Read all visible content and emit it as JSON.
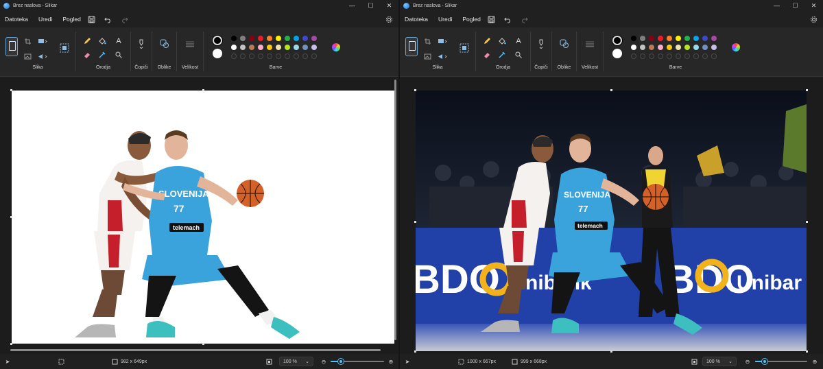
{
  "windows": [
    {
      "title": "Brez naslova - Slikar",
      "menu": [
        "Datoteka",
        "Uredi",
        "Pogled"
      ],
      "ribbon": {
        "groups": [
          "Slika",
          "Orodja",
          "Čopiči",
          "Oblike",
          "Velikost",
          "Barve"
        ]
      },
      "status": {
        "image_size": "982 x 649px",
        "zoom": "100 %"
      }
    },
    {
      "title": "Brez naslova - Slikar",
      "menu": [
        "Datoteka",
        "Uredi",
        "Pogled"
      ],
      "ribbon": {
        "groups": [
          "Slika",
          "Orodja",
          "Čopiči",
          "Oblike",
          "Velikost",
          "Barve"
        ]
      },
      "status": {
        "selection_size": "1000 x 667px",
        "image_size": "999 x 668px",
        "zoom": "100 %"
      },
      "banner": {
        "left_text": "BDO",
        "left_sub": "nibank",
        "right_text": "BDO",
        "right_sub": "Unibar"
      }
    }
  ],
  "player": {
    "team": "SLOVENIJA",
    "number": "77",
    "sponsor": "telemach"
  },
  "palette": {
    "row1": [
      "#000000",
      "#7f7f7f",
      "#880015",
      "#ed1c24",
      "#ff7f27",
      "#fff200",
      "#22b14c",
      "#00a2e8",
      "#3f48cc",
      "#a349a4"
    ],
    "row2": [
      "#ffffff",
      "#c3c3c3",
      "#b97a57",
      "#ffaec9",
      "#ffc90e",
      "#efe4b0",
      "#b5e61d",
      "#99d9ea",
      "#7092be",
      "#c8bfe7"
    ]
  },
  "colors": {
    "accent": "#4cc2ff",
    "jersey_home": "#3aa3dc",
    "jersey_away": "#f4f1ee",
    "banner_blue": "#2140a8",
    "banner_gold": "#f2b21b"
  }
}
